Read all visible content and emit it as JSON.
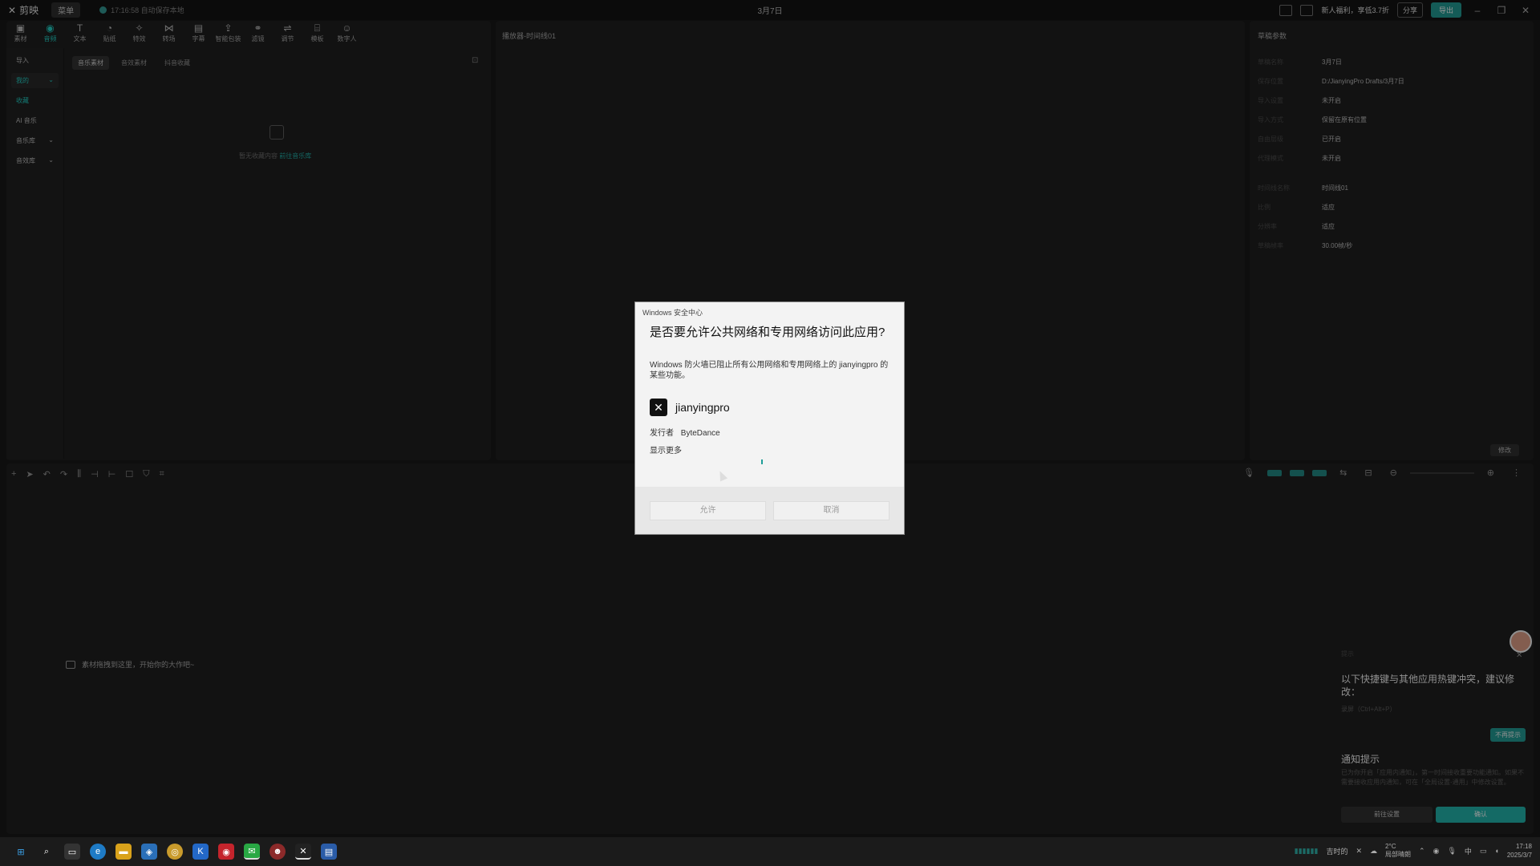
{
  "titlebar": {
    "app_name": "剪映",
    "menu": "菜单",
    "save_status": "17:16:58 自动保存本地",
    "project_title": "3月7日",
    "promo": "新人福利，享低3.7折",
    "share": "分享",
    "export": "导出"
  },
  "toolbar": [
    "素材",
    "音频",
    "文本",
    "贴纸",
    "特效",
    "转场",
    "字幕",
    "智能包装",
    "滤镜",
    "调节",
    "模板",
    "数字人"
  ],
  "sidebar": {
    "items": [
      {
        "label": "导入"
      },
      {
        "label": "我的"
      },
      {
        "label": "收藏"
      },
      {
        "label": "AI 音乐"
      },
      {
        "label": "音乐库"
      },
      {
        "label": "音效库"
      }
    ]
  },
  "media_tabs": [
    "音乐素材",
    "音效素材",
    "抖音收藏"
  ],
  "media_empty": {
    "text": "暂无收藏内容",
    "link": "前往音乐库"
  },
  "preview": {
    "title": "播放器-时间线01"
  },
  "inspector": {
    "title": "草稿参数",
    "rows": [
      {
        "key": "草稿名称",
        "value": "3月7日"
      },
      {
        "key": "保存位置",
        "value": "D:/JianyingPro Drafts/3月7日"
      },
      {
        "key": "导入设置",
        "value": "未开启"
      },
      {
        "key": "导入方式",
        "value": "保留在原有位置"
      },
      {
        "key": "自由层级",
        "value": "已开启"
      },
      {
        "key": "代理模式",
        "value": "未开启"
      },
      {
        "key": "时间线名称",
        "value": "时间线01"
      },
      {
        "key": "比例",
        "value": "适应"
      },
      {
        "key": "分辨率",
        "value": "适应"
      },
      {
        "key": "草稿帧率",
        "value": "30.00帧/秒"
      }
    ],
    "modify": "修改"
  },
  "timeline": {
    "drop_hint": "素材拖拽到这里，开始你的大作吧~"
  },
  "notice": {
    "small_head": "提示",
    "warning": "以下快捷键与其他应用热键冲突，建议修改：",
    "shortcut": "录屏（Ctrl+Alt+P）",
    "no_remind": "不再提示",
    "title": "通知提示",
    "desc": "已为你开启「应用内通知」，第一时间接收重要功能通知。如果不需要接收应用内通知，可在「全局设置-通用」中修改设置。",
    "go_settings": "前往设置",
    "ok": "确认"
  },
  "dialog": {
    "caption": "Windows 安全中心",
    "heading": "是否要允许公共网络和专用网络访问此应用?",
    "body": "Windows 防火墙已阻止所有公用网络和专用网络上的 jianyingpro 的某些功能。",
    "app_name": "jianyingpro",
    "publisher_key": "发行者",
    "publisher_value": "ByteDance",
    "more": "显示更多",
    "allow": "允许",
    "cancel": "取消"
  },
  "taskbar": {
    "tray_text": "吉时的",
    "weather_temp": "2°C",
    "weather_desc": "局部晴朗",
    "time": "17:18",
    "date": "2025/3/7"
  }
}
